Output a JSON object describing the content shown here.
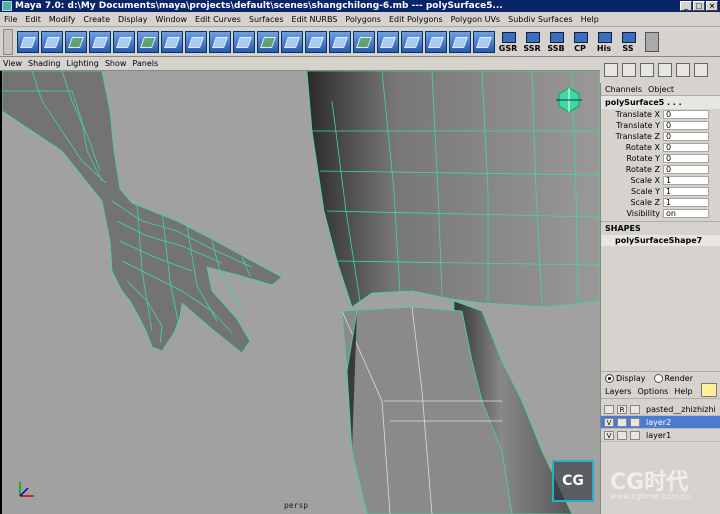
{
  "window": {
    "title": "Maya 7.0: d:\\My Documents\\maya\\projects\\default\\scenes\\shangchilong-6.mb  ---  polySurface5..."
  },
  "menubar": [
    "File",
    "Edit",
    "Modify",
    "Create",
    "Display",
    "Window",
    "Edit Curves",
    "Surfaces",
    "Edit NURBS",
    "Polygons",
    "Edit Polygons",
    "Polygon UVs",
    "Subdiv Surfaces",
    "Help"
  ],
  "shelf": {
    "text_buttons": [
      "GSR",
      "SSR",
      "SSB",
      "CP",
      "His",
      "SS"
    ]
  },
  "viewport": {
    "menu": [
      "View",
      "Shading",
      "Lighting",
      "Show",
      "Panels"
    ],
    "camera_label": "persp",
    "background": "#a1a1a1",
    "wire_color": "#3ed9a0"
  },
  "channel_box": {
    "tabs": [
      "Channels",
      "Object"
    ],
    "object_name": "polySurface5 . . .",
    "attributes": [
      {
        "name": "Translate X",
        "value": "0"
      },
      {
        "name": "Translate Y",
        "value": "0"
      },
      {
        "name": "Translate Z",
        "value": "0"
      },
      {
        "name": "Rotate X",
        "value": "0"
      },
      {
        "name": "Rotate Y",
        "value": "0"
      },
      {
        "name": "Rotate Z",
        "value": "0"
      },
      {
        "name": "Scale X",
        "value": "1"
      },
      {
        "name": "Scale Y",
        "value": "1"
      },
      {
        "name": "Scale Z",
        "value": "1"
      },
      {
        "name": "Visibility",
        "value": "on"
      }
    ],
    "shapes_header": "SHAPES",
    "shape_name": "polySurfaceShape7"
  },
  "layers": {
    "radio": [
      {
        "label": "Display",
        "selected": true
      },
      {
        "label": "Render",
        "selected": false
      }
    ],
    "menu": [
      "Layers",
      "Options",
      "Help"
    ],
    "rows": [
      {
        "vis": "",
        "type": "R",
        "name": "pasted__zhizhizhi",
        "selected": false
      },
      {
        "vis": "V",
        "type": "",
        "name": "layer2",
        "selected": true
      },
      {
        "vis": "V",
        "type": "",
        "name": "layer1",
        "selected": false
      }
    ]
  },
  "watermark": {
    "logo_text": "CG",
    "brand": "CG时代",
    "url": "www.cgtime.com.cn"
  }
}
